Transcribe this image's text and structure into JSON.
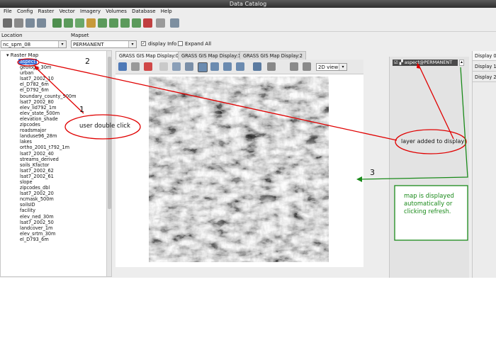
{
  "window": {
    "title": "Data Catalog"
  },
  "menu": [
    "File",
    "Config",
    "Raster",
    "Vector",
    "Imagery",
    "Volumes",
    "Database",
    "Help"
  ],
  "toolbar_icons": [
    "new-display-icon",
    "workspace-open-icon",
    "upload-icon",
    "download-icon",
    "add-raster-icon",
    "add-vector-icon",
    "add-rgb-icon",
    "add-group-icon",
    "add-overlay-icon",
    "add-command-icon",
    "add-label-icon",
    "add-grid-icon",
    "delete-layer-icon",
    "attribute-table-icon"
  ],
  "location": {
    "label": "Location",
    "value": "nc_spm_08"
  },
  "mapset": {
    "label": "Mapset",
    "value": "PERMANENT"
  },
  "display_info": {
    "label": "display Info",
    "checked": true
  },
  "expand_all": {
    "label": "Expand All",
    "checked": false
  },
  "tree": {
    "root": "Raster Map",
    "items": [
      "aspect",
      "geology_30m",
      "urban",
      "lsat7_2002_10",
      "el_D782_6m",
      "el_D792_6m",
      "boundary_county_500m",
      "lsat7_2002_80",
      "elev_lid792_1m",
      "elev_state_500m",
      "elevation_shade",
      "zipcodes",
      "roadsmajor",
      "landuse96_28m",
      "lakes",
      "ortho_2001_t792_1m",
      "lsat7_2002_40",
      "streams_derived",
      "soils_Kfactor",
      "lsat7_2002_62",
      "lsat7_2002_61",
      "slope",
      "zipcodes_dbl",
      "lsat7_2002_20",
      "ncmask_500m",
      "soilsID",
      "facility",
      "elev_ned_30m",
      "lsat7_2002_50",
      "landcover_1m",
      "elev_srtm_30m",
      "el_D793_6m"
    ]
  },
  "map_tabs": [
    "GRASS GIS Map Display:0",
    "GRASS GIS Map Display:1",
    "GRASS GIS Map Display:2"
  ],
  "view_select": "2D view",
  "layer_manager": {
    "layer": "aspect@PERMANENT",
    "checked": true
  },
  "display_tabs": [
    "Display 0",
    "Display 1",
    "Display 2"
  ],
  "annotations": {
    "step1": "1",
    "step2": "2",
    "step3": "3",
    "double_click": "user double click",
    "layer_added": "layer added to display",
    "map_displayed": "map is displayed automatically or clicking refresh."
  },
  "colors": {
    "red_note": "#e00000",
    "green_note": "#1a8a1a",
    "selection": "#3b6fd4",
    "titlebar": "#3a3a3a"
  }
}
